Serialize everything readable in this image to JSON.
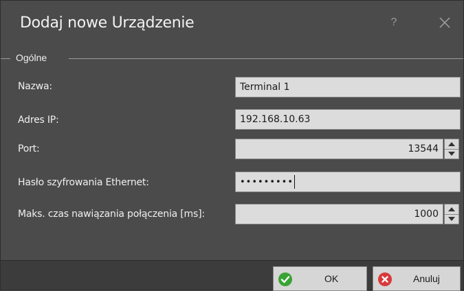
{
  "window": {
    "title": "Dodaj nowe Urządzenie",
    "help_label": "?",
    "close_icon": "close-icon"
  },
  "group": {
    "title": "Ogólne"
  },
  "fields": {
    "name": {
      "label": "Nazwa:",
      "value": "Terminal 1"
    },
    "ip": {
      "label": "Adres IP:",
      "value": "192.168.10.63"
    },
    "port": {
      "label": "Port:",
      "value": "13544"
    },
    "password": {
      "label": "Hasło szyfrowania Ethernet:",
      "value": "•••••••••"
    },
    "timeout": {
      "label": "Maks. czas nawiązania połączenia [ms]:",
      "value": "1000"
    }
  },
  "buttons": {
    "ok": {
      "label": "OK",
      "icon": "check-icon",
      "color": "#3aa335"
    },
    "cancel": {
      "label": "Anuluj",
      "icon": "cancel-icon",
      "color": "#d83a3a"
    }
  }
}
